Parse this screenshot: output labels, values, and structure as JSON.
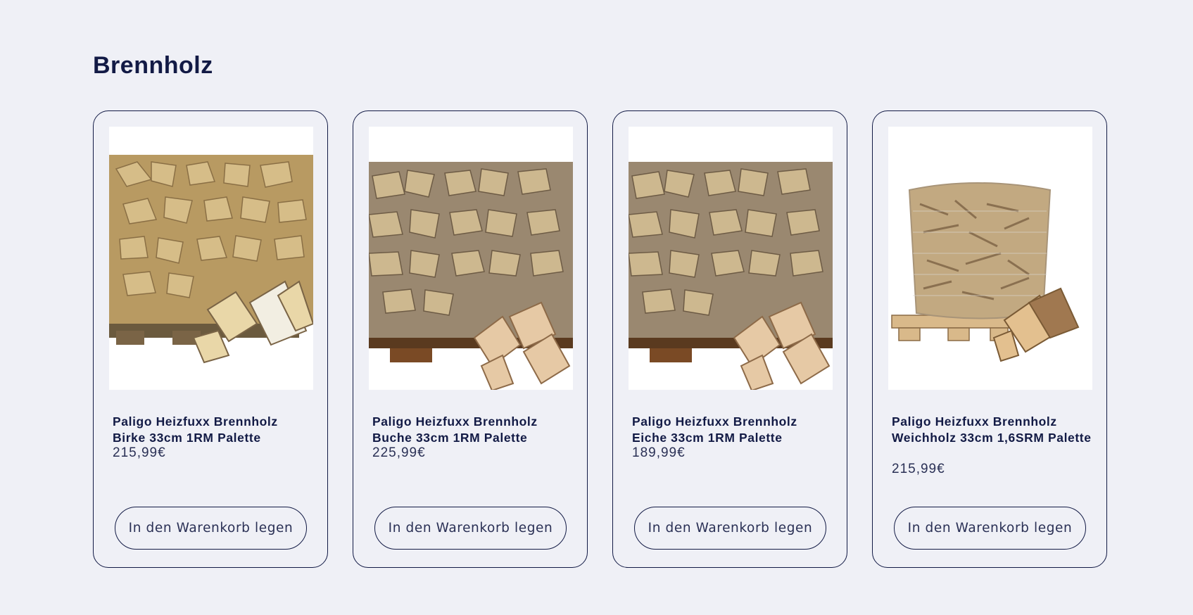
{
  "section": {
    "title": "Brennholz"
  },
  "products": [
    {
      "name": "Paligo Heizfuxx Brennholz Birke 33cm 1RM Palette",
      "price": "215,99€",
      "button": "In den Warenkorb legen",
      "image_icon": "firewood-pallet-birch-image"
    },
    {
      "name": "Paligo Heizfuxx Brennholz Buche 33cm 1RM Palette",
      "price": "225,99€",
      "button": "In den Warenkorb legen",
      "image_icon": "firewood-pallet-beech-image"
    },
    {
      "name": "Paligo Heizfuxx Brennholz Eiche 33cm 1RM Palette",
      "price": "189,99€",
      "button": "In den Warenkorb legen",
      "image_icon": "firewood-pallet-oak-image"
    },
    {
      "name": "Paligo Heizfuxx Brennholz Weichholz 33cm 1,6SRM Palette",
      "price": "215,99€",
      "button": "In den Warenkorb legen",
      "image_icon": "firewood-bag-softwood-image"
    }
  ],
  "colors": {
    "background": "#eff0f6",
    "text": "#121a45",
    "border": "#121a45"
  }
}
